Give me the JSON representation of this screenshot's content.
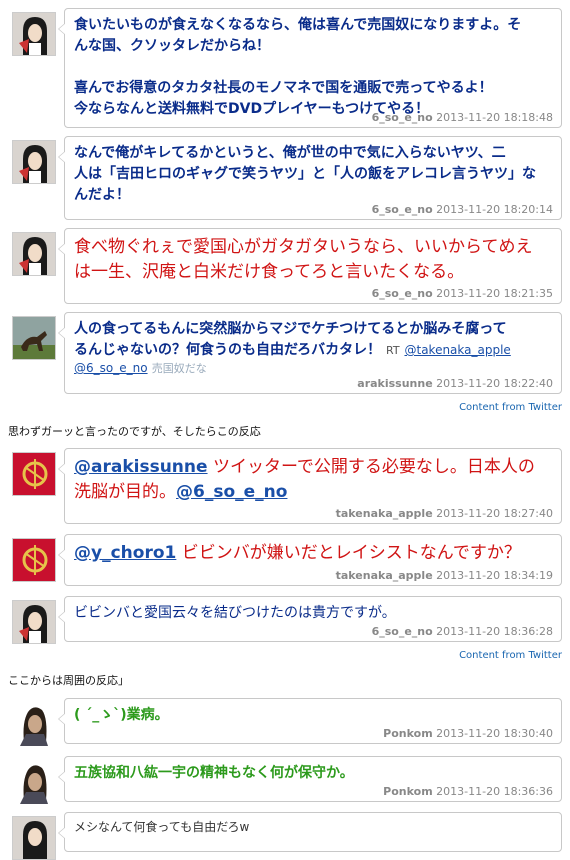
{
  "tweets": [
    {
      "avatar": "girl-avatar",
      "lines": [
        "食いたいものが食えなくなるなら、俺は喜んで売国奴になりますよ。そ",
        "んな国、クソッタレだからね！",
        "",
        "喜んでお得意のタカタ社長のモノマネで国を通販で売ってやるよ！",
        "今ならなんと送料無料でDVDプレイヤーもつけてやる！"
      ],
      "user": "6_so_e_no",
      "time": "2013-11-20 18:18:48"
    },
    {
      "avatar": "girl-avatar",
      "lines": [
        "なんで俺がキレてるかというと、俺が世の中で気に入らないヤツ、二",
        "人は「吉田ヒロのギャグで笑うヤツ」と「人の飯をアレコレ言うヤツ」な",
        "んだよ！"
      ],
      "user": "6_so_e_no",
      "time": "2013-11-20 18:20:14"
    },
    {
      "avatar": "girl-avatar",
      "lines": [
        "食べ物ぐれぇで愛国心がガタガタいうなら、いいからてめえ",
        "は一生、沢庵と白米だけ食ってろと言いたくなる。"
      ],
      "user": "6_so_e_no",
      "time": "2013-11-20 18:21:35"
    },
    {
      "avatar": "horse-avatar",
      "line1": "人の食ってるもんに突然脳からマジでケチつけてるとか脳みそ腐って",
      "line2": "るんじゃないの？何食うのも自由だろバカタレ！",
      "rt": "RT",
      "rt_link": "@takenaka_apple",
      "line3_link": "@6_so_e_no",
      "line3_faint": "売国奴だな",
      "user": "arakissunne",
      "time": "2013-11-20 18:22:40"
    },
    {
      "avatar": "emblem-avatar",
      "mention": "@arakissunne",
      "text1": "ツイッターで公開する必要なし。日本人の",
      "text2": "洗脳が目的。",
      "mention2": "@6_so_e_no",
      "user": "takenaka_apple",
      "time": "2013-11-20 18:27:40"
    },
    {
      "avatar": "emblem-avatar",
      "mention": "@y_choro1",
      "text1": "ビビンバが嫌いだとレイシストなんですか？",
      "user": "takenaka_apple",
      "time": "2013-11-20 18:34:19"
    },
    {
      "avatar": "girl-avatar",
      "text": "ビビンバと愛国云々を結びつけたのは貴方ですが。",
      "user": "6_so_e_no",
      "time": "2013-11-20 18:36:28"
    },
    {
      "avatar": "man-avatar",
      "text": "( ´_ゝ`)業病。",
      "user": "Ponkom",
      "time": "2013-11-20 18:30:40"
    },
    {
      "avatar": "man-avatar",
      "text": "五族協和八紘一宇の精神もなく何が保守か。",
      "user": "Ponkom",
      "time": "2013-11-20 18:36:36"
    },
    {
      "avatar": "girl-avatar",
      "text": "メシなんて何食っても自由だろw"
    }
  ],
  "content_from": "Content from Twitter",
  "notes": {
    "first": "思わずガーッと言ったのですが、そしたらこの反応",
    "second": "ここからは周囲の反応」"
  },
  "colors": {
    "tweet_blue": "#0a2c8a",
    "tweet_red": "#d01414",
    "tweet_green": "#2c9a1c",
    "link": "#1a4fa8"
  }
}
